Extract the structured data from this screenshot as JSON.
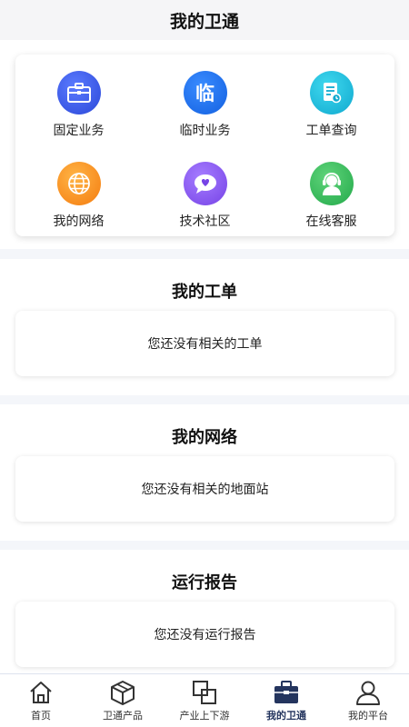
{
  "header": {
    "title": "我的卫通"
  },
  "grid": {
    "items": [
      {
        "label": "固定业务",
        "icon": "briefcase-icon",
        "color": "#2b48d8"
      },
      {
        "label": "临时业务",
        "icon": "temporary-char-icon",
        "glyph": "临",
        "color": "#1360e0"
      },
      {
        "label": "工单查询",
        "icon": "document-search-icon",
        "color": "#10a9cf"
      },
      {
        "label": "我的网络",
        "icon": "globe-icon",
        "color": "#f47c10"
      },
      {
        "label": "技术社区",
        "icon": "chat-heart-icon",
        "color": "#7643e6"
      },
      {
        "label": "在线客服",
        "icon": "headset-agent-icon",
        "color": "#23a94a"
      }
    ]
  },
  "work_orders": {
    "title": "我的工单",
    "empty_text": "您还没有相关的工单"
  },
  "network": {
    "title": "我的网络",
    "empty_text": "您还没有相关的地面站"
  },
  "reports": {
    "title": "运行报告",
    "empty_text": "您还没有运行报告"
  },
  "tabbar": {
    "active_color": "#24355e",
    "items": [
      {
        "label": "首页",
        "icon": "home-icon"
      },
      {
        "label": "卫通产品",
        "icon": "cube-icon"
      },
      {
        "label": "产业上下游",
        "icon": "overlap-squares-icon"
      },
      {
        "label": "我的卫通",
        "icon": "toolbox-icon",
        "active": true
      },
      {
        "label": "我的平台",
        "icon": "user-icon"
      }
    ]
  }
}
